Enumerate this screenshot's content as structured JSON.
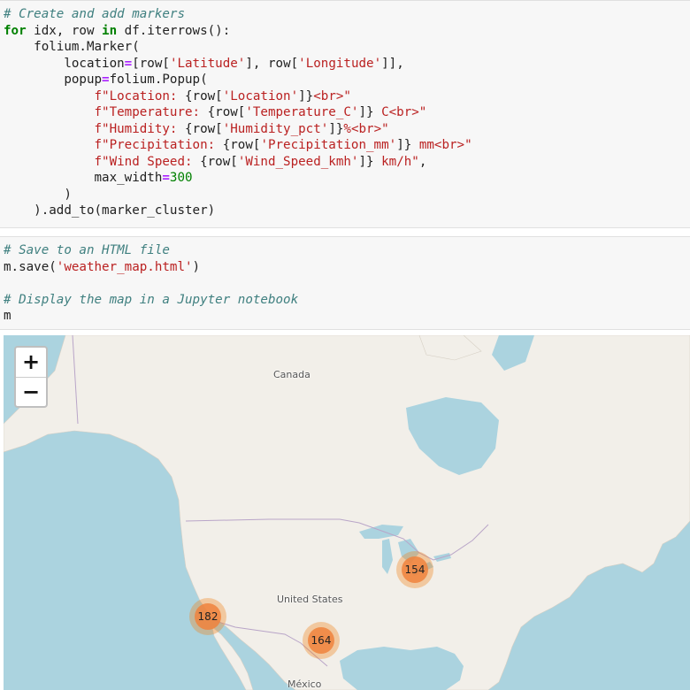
{
  "cells": {
    "code1": [
      [
        {
          "t": "# Create and add markers",
          "c": "cm"
        }
      ],
      [
        {
          "t": "for",
          "c": "kw"
        },
        {
          "t": " idx, row "
        },
        {
          "t": "in",
          "c": "kw"
        },
        {
          "t": " df.iterrows():"
        }
      ],
      [
        {
          "t": "    folium.Marker("
        }
      ],
      [
        {
          "t": "        location"
        },
        {
          "t": "=",
          "c": "op"
        },
        {
          "t": "[row["
        },
        {
          "t": "'Latitude'",
          "c": "st"
        },
        {
          "t": "], row["
        },
        {
          "t": "'Longitude'",
          "c": "st"
        },
        {
          "t": "]],"
        }
      ],
      [
        {
          "t": "        popup"
        },
        {
          "t": "=",
          "c": "op"
        },
        {
          "t": "folium.Popup("
        }
      ],
      [
        {
          "t": "            "
        },
        {
          "t": "f\"Location: ",
          "c": "st"
        },
        {
          "t": "{row["
        },
        {
          "t": "'Location'",
          "c": "st"
        },
        {
          "t": "]}"
        },
        {
          "t": "<br>\"",
          "c": "st"
        }
      ],
      [
        {
          "t": "            "
        },
        {
          "t": "f\"Temperature: ",
          "c": "st"
        },
        {
          "t": "{row["
        },
        {
          "t": "'Temperature_C'",
          "c": "st"
        },
        {
          "t": "]}"
        },
        {
          "t": " C<br>\"",
          "c": "st"
        }
      ],
      [
        {
          "t": "            "
        },
        {
          "t": "f\"Humidity: ",
          "c": "st"
        },
        {
          "t": "{row["
        },
        {
          "t": "'Humidity_pct'",
          "c": "st"
        },
        {
          "t": "]}"
        },
        {
          "t": "%<br>\"",
          "c": "st"
        }
      ],
      [
        {
          "t": "            "
        },
        {
          "t": "f\"Precipitation: ",
          "c": "st"
        },
        {
          "t": "{row["
        },
        {
          "t": "'Precipitation_mm'",
          "c": "st"
        },
        {
          "t": "]}"
        },
        {
          "t": " mm<br>\"",
          "c": "st"
        }
      ],
      [
        {
          "t": "            "
        },
        {
          "t": "f\"Wind Speed: ",
          "c": "st"
        },
        {
          "t": "{row["
        },
        {
          "t": "'Wind_Speed_kmh'",
          "c": "st"
        },
        {
          "t": "]}"
        },
        {
          "t": " km/h\"",
          "c": "st"
        },
        {
          "t": ","
        }
      ],
      [
        {
          "t": "            max_width"
        },
        {
          "t": "=",
          "c": "op"
        },
        {
          "t": "300",
          "c": "nm"
        }
      ],
      [
        {
          "t": "        )"
        }
      ],
      [
        {
          "t": "    ).add_to(marker_cluster)"
        }
      ]
    ],
    "code2": [
      [
        {
          "t": "# Save to an HTML file",
          "c": "cm"
        }
      ],
      [
        {
          "t": "m.save("
        },
        {
          "t": "'weather_map.html'",
          "c": "st"
        },
        {
          "t": ")"
        }
      ],
      [
        {
          "t": ""
        }
      ],
      [
        {
          "t": "# Display the map in a Jupyter notebook",
          "c": "cm"
        }
      ],
      [
        {
          "t": "m"
        }
      ]
    ]
  },
  "map": {
    "zoom_in": "+",
    "zoom_out": "−",
    "labels": {
      "canada": "Canada",
      "usa": "United States",
      "mexico": "México"
    },
    "clusters": [
      {
        "count": "154"
      },
      {
        "count": "182"
      },
      {
        "count": "164"
      }
    ]
  }
}
